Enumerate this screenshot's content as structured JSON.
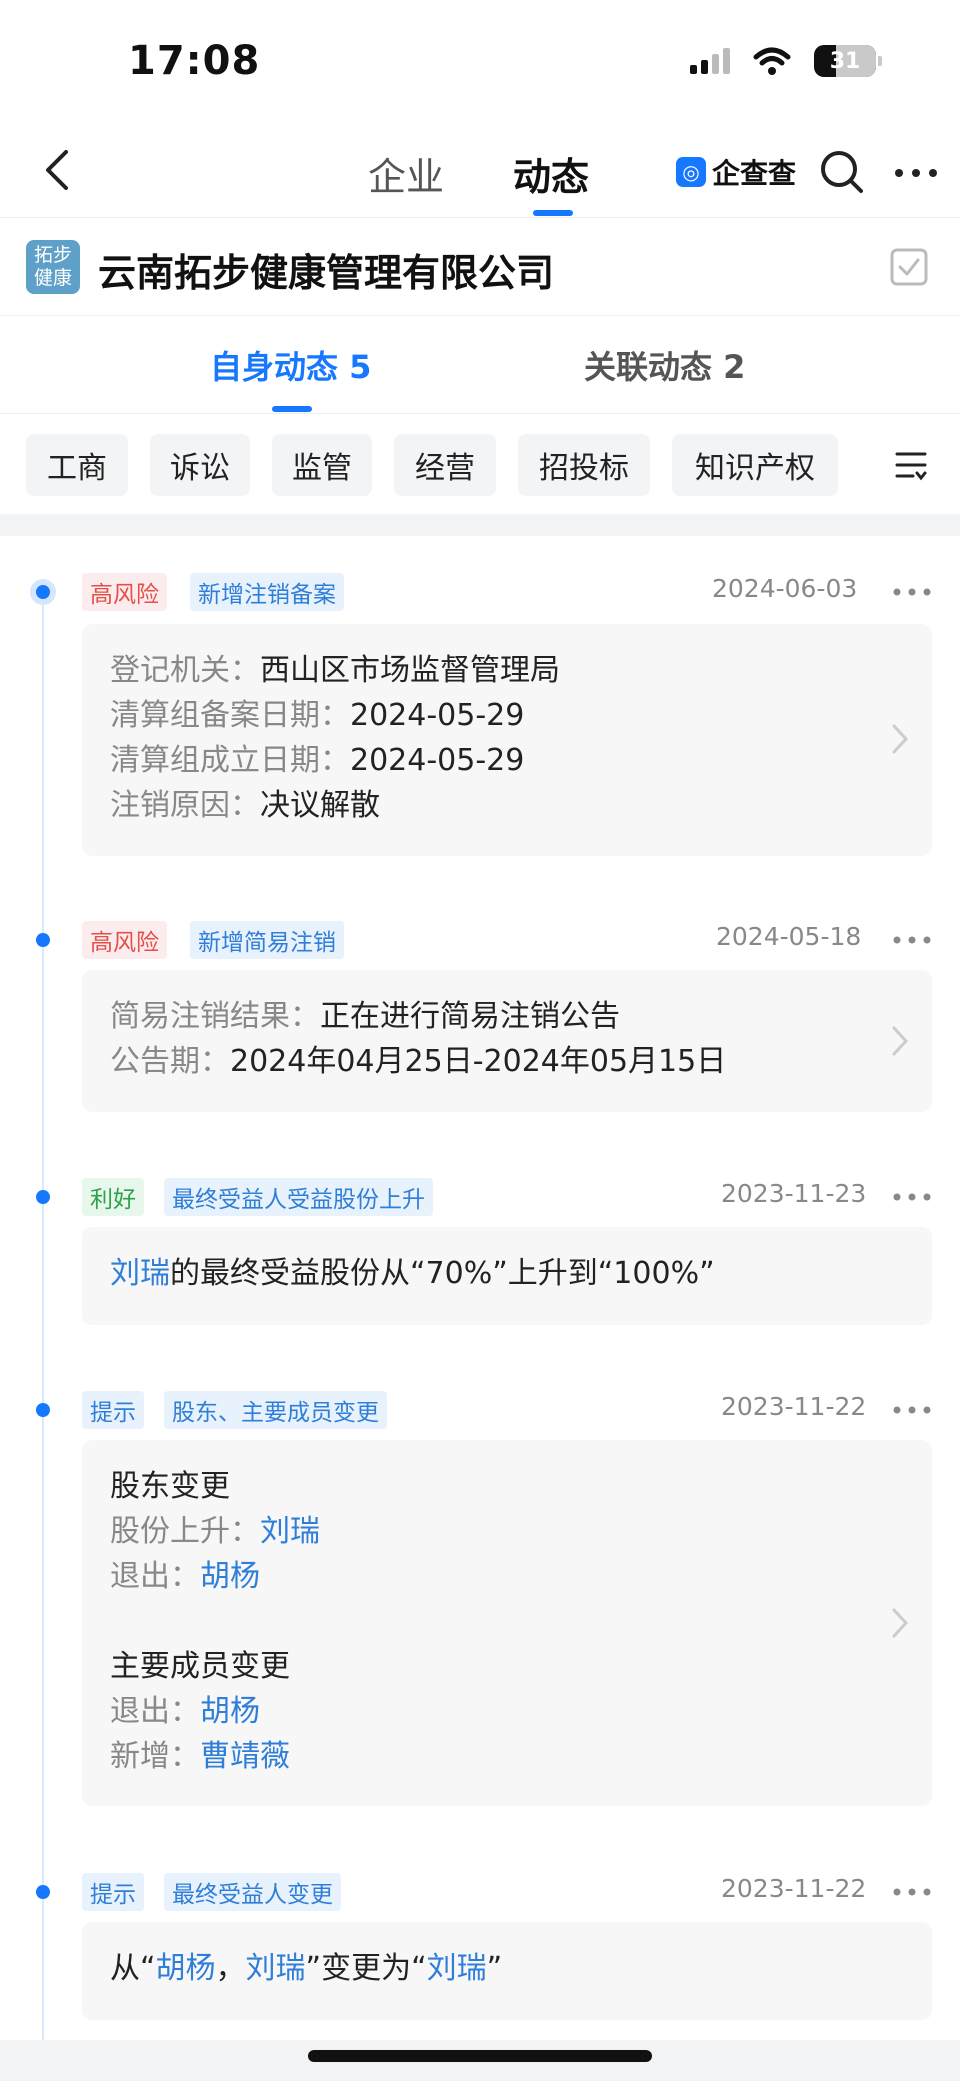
{
  "status_bar": {
    "time": "17:08",
    "battery": "31"
  },
  "nav": {
    "tabs": [
      "企业",
      "动态"
    ],
    "active_tab": "动态",
    "brand_text": "企查查",
    "brand_logo": "◎"
  },
  "company": {
    "logo_line1": "拓步",
    "logo_line2": "健康",
    "name": "云南拓步健康管理有限公司"
  },
  "sub_tabs": [
    {
      "label": "自身动态 5",
      "active": true
    },
    {
      "label": "关联动态 2",
      "active": false
    }
  ],
  "filters": [
    "工商",
    "诉讼",
    "监管",
    "经营",
    "招投标",
    "知识产权"
  ],
  "icons": [
    "back-icon",
    "search-icon",
    "more-icon",
    "follow-checkbox-icon",
    "filter-menu-icon",
    "chevron-right-icon"
  ],
  "colors": {
    "accent": "#1677ff",
    "risk": "#e3504a",
    "good": "#2fa14a",
    "link": "#2f7ed8"
  },
  "events": [
    {
      "tags": [
        {
          "text": "高风险",
          "kind": "risk"
        },
        {
          "text": "新增注销备案",
          "kind": "blue"
        }
      ],
      "date": "2024-06-03",
      "rows": [
        {
          "label": "登记机关：",
          "value": "西山区市场监督管理局"
        },
        {
          "label": "清算组备案日期：",
          "value": "2024-05-29"
        },
        {
          "label": "清算组成立日期：",
          "value": "2024-05-29"
        },
        {
          "label": "注销原因：",
          "value": "决议解散"
        }
      ]
    },
    {
      "tags": [
        {
          "text": "高风险",
          "kind": "risk"
        },
        {
          "text": "新增简易注销",
          "kind": "blue"
        }
      ],
      "date": "2024-05-18",
      "rows": [
        {
          "label": "简易注销结果：",
          "value": "正在进行简易注销公告"
        },
        {
          "label": "公告期：",
          "value": "2024年04月25日-2024年05月15日"
        }
      ]
    },
    {
      "tags": [
        {
          "text": "利好",
          "kind": "good"
        },
        {
          "text": "最终受益人受益股份上升",
          "kind": "blue"
        }
      ],
      "date": "2023-11-23",
      "text": {
        "person": "刘瑞",
        "rest": "的最终受益股份从“70%”上升到“100%”"
      }
    },
    {
      "tags": [
        {
          "text": "提示",
          "kind": "blue"
        },
        {
          "text": "股东、主要成员变更",
          "kind": "blue"
        }
      ],
      "date": "2023-11-22",
      "shareholder_title": "股东变更",
      "shareholder_rows": [
        {
          "label": "股份上升：",
          "value": "刘瑞"
        },
        {
          "label": "退出：",
          "value": "胡杨"
        }
      ],
      "member_title": "主要成员变更",
      "member_rows": [
        {
          "label": "退出：",
          "value": "胡杨"
        },
        {
          "label": "新增：",
          "value": "曹靖薇"
        }
      ]
    },
    {
      "tags": [
        {
          "text": "提示",
          "kind": "blue"
        },
        {
          "text": "最终受益人变更",
          "kind": "blue"
        }
      ],
      "date": "2023-11-22",
      "text": {
        "p1": "从“",
        "n1": "胡杨",
        "p2": "，",
        "n2": "刘瑞",
        "p3": "”变更为“",
        "n3": "刘瑞",
        "p4": "”"
      }
    }
  ]
}
